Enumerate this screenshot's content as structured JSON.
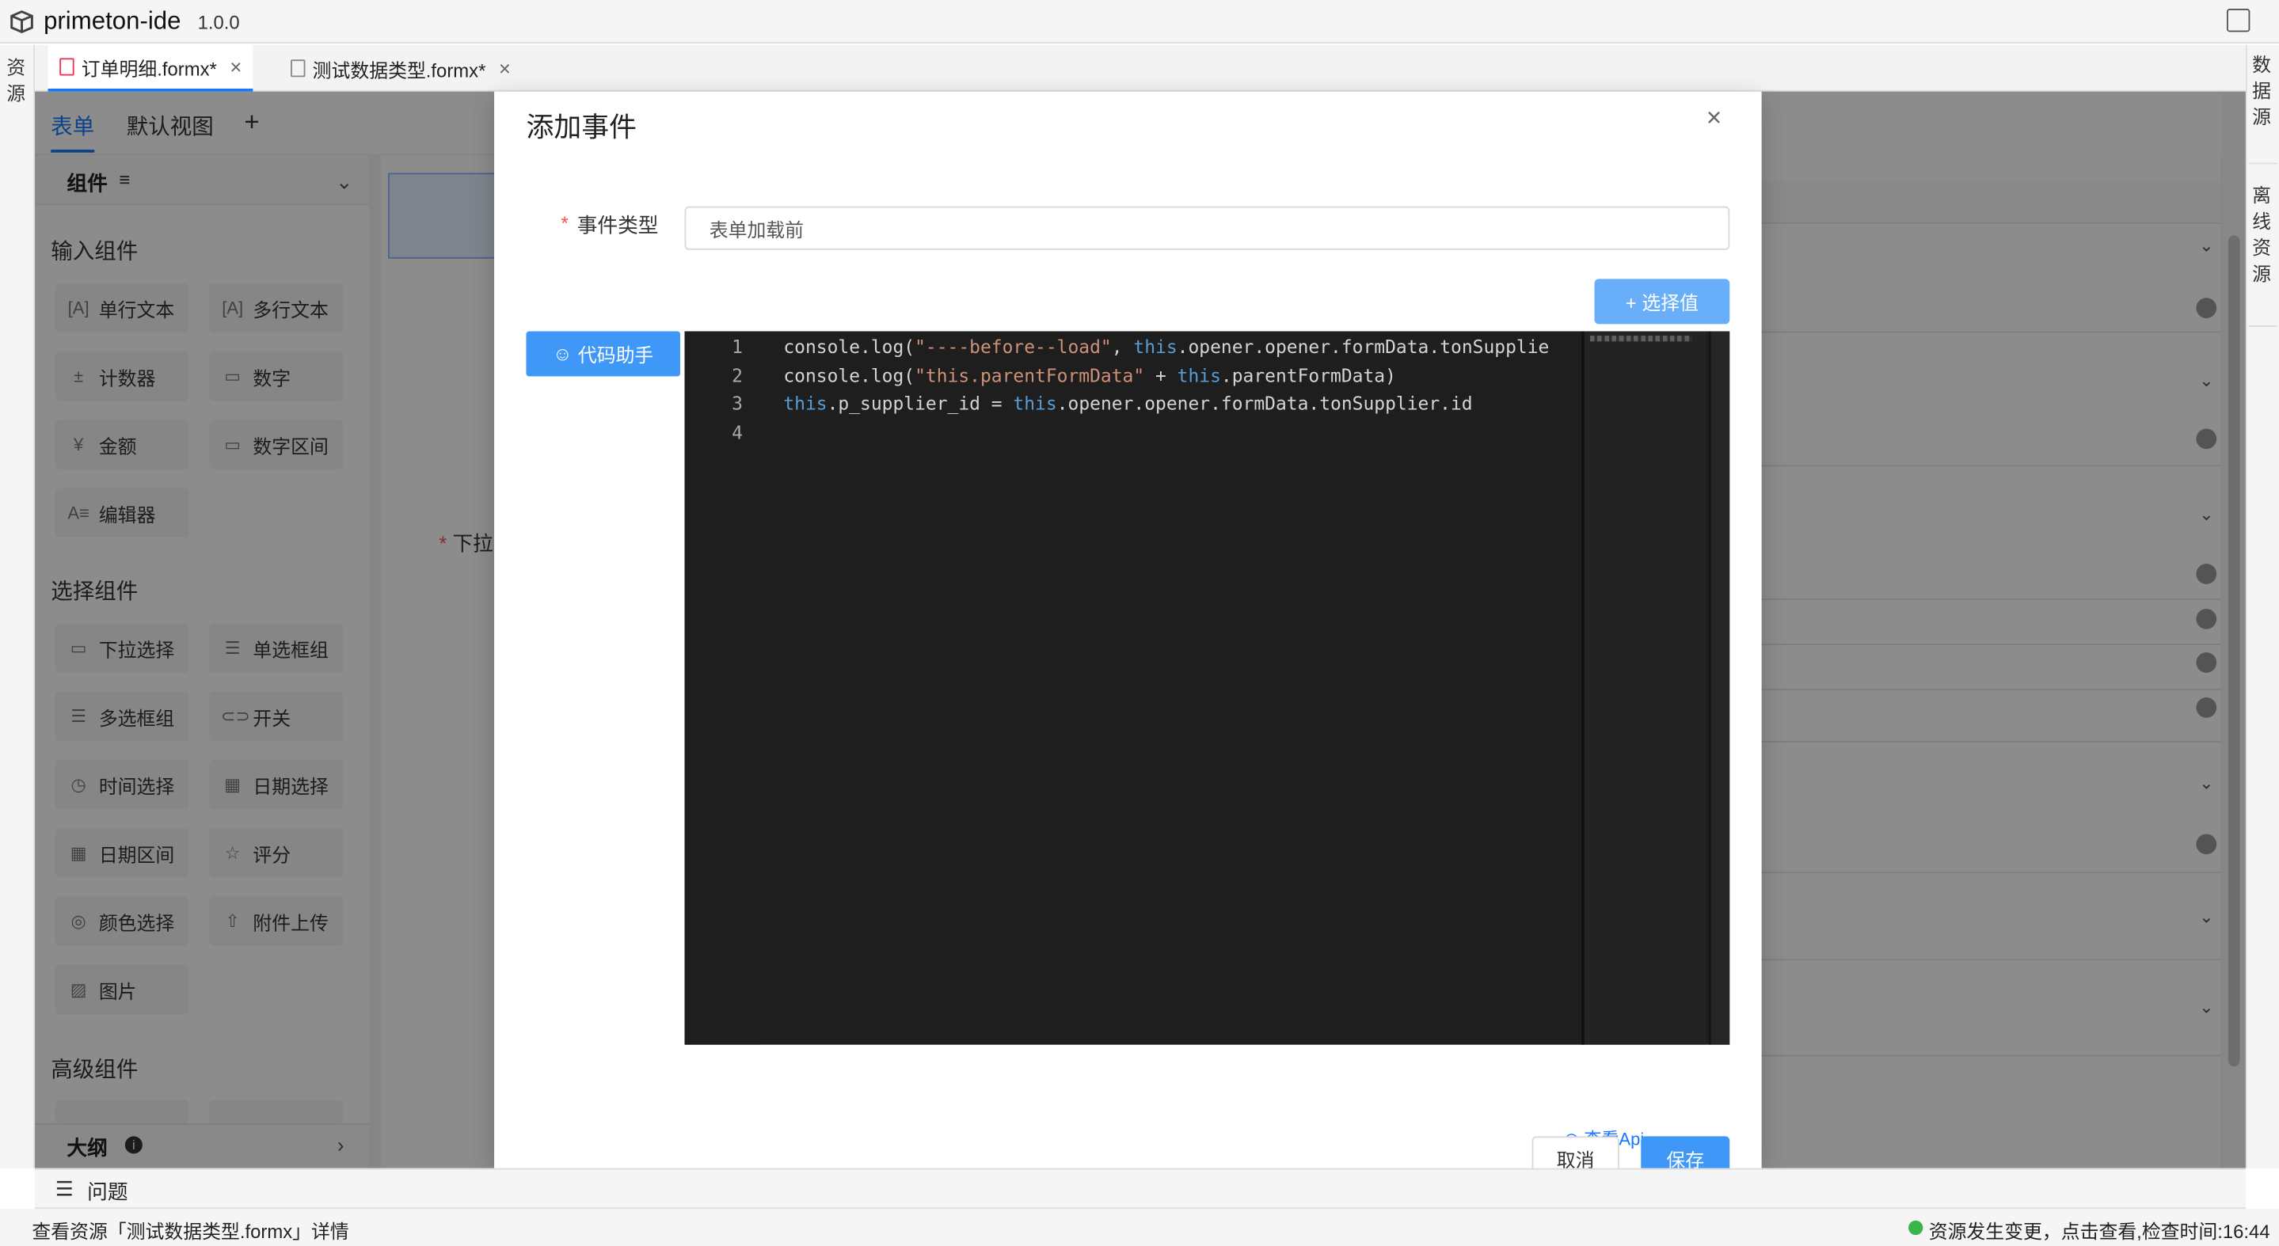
{
  "app": {
    "title": "primeton-ide",
    "version": "1.0.0"
  },
  "left_rail": {
    "label": "资源"
  },
  "right_rail": {
    "items": [
      "数据源",
      "离线资源"
    ]
  },
  "file_tabs": [
    {
      "label": "订单明细.formx*",
      "active": true
    },
    {
      "label": "测试数据类型.formx*",
      "active": false
    }
  ],
  "view_tabs": {
    "items": [
      "表单",
      "默认视图"
    ],
    "add": "+"
  },
  "components": {
    "header": "组件",
    "header_icon": "≡",
    "sections": [
      {
        "title": "输入组件",
        "items": [
          {
            "icon": "[A]",
            "label": "单行文本"
          },
          {
            "icon": "[A]",
            "label": "多行文本"
          },
          {
            "icon": "±",
            "label": "计数器"
          },
          {
            "icon": "▭",
            "label": "数字"
          },
          {
            "icon": "¥",
            "label": "金额"
          },
          {
            "icon": "▭",
            "label": "数字区间"
          },
          {
            "icon": "A≡",
            "label": "编辑器"
          }
        ]
      },
      {
        "title": "选择组件",
        "items": [
          {
            "icon": "▭",
            "label": "下拉选择"
          },
          {
            "icon": "☰",
            "label": "单选框组"
          },
          {
            "icon": "☰",
            "label": "多选框组"
          },
          {
            "icon": "⊂⊃",
            "label": "开关"
          },
          {
            "icon": "◷",
            "label": "时间选择"
          },
          {
            "icon": "▦",
            "label": "日期选择"
          },
          {
            "icon": "▦",
            "label": "日期区间"
          },
          {
            "icon": "☆",
            "label": "评分"
          },
          {
            "icon": "◎",
            "label": "颜色选择"
          },
          {
            "icon": "⇧",
            "label": "附件上传"
          },
          {
            "icon": "▨",
            "label": "图片"
          }
        ]
      },
      {
        "title": "高级组件",
        "items": []
      }
    ]
  },
  "outline": {
    "label": "大纲"
  },
  "canvas": {
    "partial_label": "下拉"
  },
  "modal": {
    "title": "添加事件",
    "close": "×",
    "event_type_label": "事件类型",
    "event_type_value": "表单加载前",
    "select_value_button": "+ 选择值",
    "code_assist_button": "代码助手",
    "code_lines": [
      {
        "n": "1",
        "parts": [
          [
            "console.log(",
            ""
          ],
          [
            "\"----before--load\"",
            "str"
          ],
          [
            ", ",
            ""
          ],
          [
            "this",
            "kw"
          ],
          [
            ".opener.opener.formData.tonSupplie",
            ""
          ]
        ]
      },
      {
        "n": "2",
        "parts": [
          [
            "console.log(",
            ""
          ],
          [
            "\"this.parentFormData\"",
            "str"
          ],
          [
            " + ",
            ""
          ],
          [
            "this",
            "kw"
          ],
          [
            ".parentFormData)",
            ""
          ]
        ]
      },
      {
        "n": "3",
        "parts": [
          [
            "this",
            "kw"
          ],
          [
            ".p_supplier_id = ",
            ""
          ],
          [
            "this",
            "kw"
          ],
          [
            ".opener.opener.formData.tonSupplier.id",
            ""
          ]
        ]
      },
      {
        "n": "4",
        "parts": []
      }
    ],
    "view_api": "查看Api",
    "cancel_button": "取消",
    "save_button": "保存"
  },
  "problems": {
    "label": "问题"
  },
  "status": {
    "left": "查看资源「测试数据类型.formx」详情",
    "right": "资源发生变更，点击查看,检查时间:16:44"
  }
}
